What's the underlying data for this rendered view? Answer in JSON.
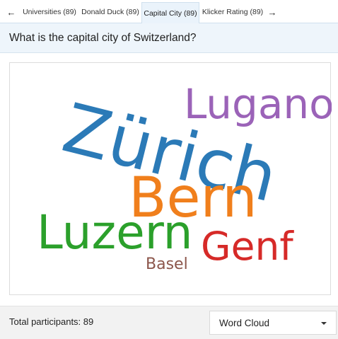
{
  "tabs": {
    "prev_icon": "arrow-left-icon",
    "next_icon": "arrow-right-icon",
    "items": [
      {
        "label": "Universities (89)",
        "active": false
      },
      {
        "label": "Donald Duck (89)",
        "active": false
      },
      {
        "label": "Capital City (89)",
        "active": true
      },
      {
        "label": "Klicker Rating (89)",
        "active": false
      }
    ]
  },
  "question": "What is the capital city of Switzerland?",
  "word_cloud": {
    "words": [
      {
        "text": "Zürich",
        "weight": 89,
        "color": "#2b7ab7"
      },
      {
        "text": "Lugano",
        "weight": 42,
        "color": "#9b63b8"
      },
      {
        "text": "Bern",
        "weight": 54,
        "color": "#f07f1c"
      },
      {
        "text": "Luzern",
        "weight": 45,
        "color": "#2ba02b"
      },
      {
        "text": "Genf",
        "weight": 38,
        "color": "#d62a28"
      },
      {
        "text": "Basel",
        "weight": 14,
        "color": "#8c564b"
      }
    ]
  },
  "footer": {
    "participants_label": "Total participants: 89",
    "view_select": "Word Cloud"
  }
}
